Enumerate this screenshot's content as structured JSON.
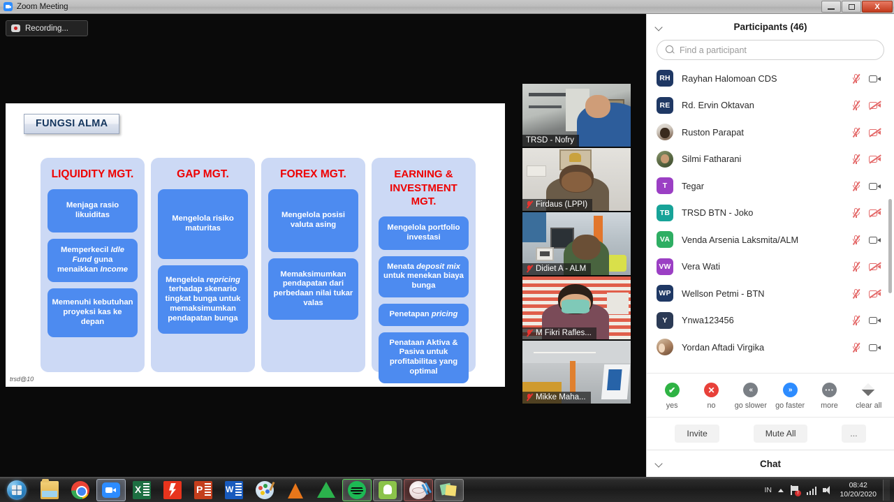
{
  "window": {
    "title": "Zoom Meeting",
    "app_icon": "zoom-icon",
    "minimize_label": "Minimize",
    "maximize_label": "Restore",
    "close_label": "X"
  },
  "stage": {
    "recording_label": "Recording...",
    "recording_icon": "record-icon"
  },
  "slide": {
    "title": "FUNGSI ALMA",
    "footer": "trsd@10",
    "columns": [
      {
        "heading": "LIQUIDITY MGT.",
        "items": [
          {
            "parts": [
              {
                "t": "Menjaga rasio likuiditas",
                "i": false
              }
            ]
          },
          {
            "parts": [
              {
                "t": "Memperkecil ",
                "i": false
              },
              {
                "t": "Idle Fund",
                "i": true
              },
              {
                "t": " guna menaikkan ",
                "i": false
              },
              {
                "t": "Income",
                "i": true
              }
            ]
          },
          {
            "parts": [
              {
                "t": "Memenuhi kebutuhan proyeksi kas ke depan",
                "i": false
              }
            ]
          }
        ]
      },
      {
        "heading": "GAP MGT.",
        "items": [
          {
            "parts": [
              {
                "t": "Mengelola risiko maturitas",
                "i": false
              }
            ]
          },
          {
            "parts": [
              {
                "t": "Mengelola ",
                "i": false
              },
              {
                "t": "repricing",
                "i": true
              },
              {
                "t": " terhadap skenario tingkat bunga untuk memaksimumkan pendapatan bunga",
                "i": false
              }
            ]
          }
        ]
      },
      {
        "heading": "FOREX MGT.",
        "items": [
          {
            "parts": [
              {
                "t": "Mengelola posisi valuta asing",
                "i": false
              }
            ]
          },
          {
            "parts": [
              {
                "t": "Memaksimumkan pendapatan dari perbedaan nilai tukar valas",
                "i": false
              }
            ]
          }
        ]
      },
      {
        "heading": "EARNING & INVESTMENT MGT.",
        "items": [
          {
            "parts": [
              {
                "t": "Mengelola portfolio investasi",
                "i": false
              }
            ]
          },
          {
            "parts": [
              {
                "t": "Menata ",
                "i": false
              },
              {
                "t": "deposit mix",
                "i": true
              },
              {
                "t": " untuk menekan biaya bunga",
                "i": false
              }
            ]
          },
          {
            "parts": [
              {
                "t": "Penetapan ",
                "i": false
              },
              {
                "t": "pricing",
                "i": true
              }
            ]
          },
          {
            "parts": [
              {
                "t": "Penataan Aktiva & Pasiva untuk profitabilitas yang optimal",
                "i": false
              }
            ]
          }
        ]
      }
    ],
    "colors": {
      "heading": "#ee0000",
      "column_bg": "#ccd9f5",
      "box_bg": "#4d8bf0"
    }
  },
  "thumbnails": [
    {
      "name": "TRSD - Nofry",
      "active": true,
      "muted": false
    },
    {
      "name": "Firdaus (LPPI)",
      "active": false,
      "muted": true
    },
    {
      "name": "Didiet A - ALM",
      "active": false,
      "muted": true
    },
    {
      "name": "M Fikri Rafles...",
      "active": false,
      "muted": true
    },
    {
      "name": "Mikke Maha...",
      "active": false,
      "muted": true
    }
  ],
  "panel": {
    "title": "Participants (46)",
    "collapse_icon": "chevron-down-icon",
    "search": {
      "placeholder": "Find a participant",
      "value": "",
      "icon": "search-icon"
    },
    "participants": [
      {
        "name": "Rayhan Halomoan CDS",
        "initials": "RH",
        "avatar_color": "#1f3864",
        "photo": null,
        "mic": "muted",
        "camera": "on"
      },
      {
        "name": "Rd. Ervin Oktavan",
        "initials": "RE",
        "avatar_color": "#1f3864",
        "photo": null,
        "mic": "muted",
        "camera": "off"
      },
      {
        "name": "Ruston Parapat",
        "initials": "",
        "avatar_color": "",
        "photo": "ph-a",
        "mic": "muted",
        "camera": "off"
      },
      {
        "name": "Silmi Fatharani",
        "initials": "",
        "avatar_color": "",
        "photo": "ph-b",
        "mic": "muted",
        "camera": "off"
      },
      {
        "name": "Tegar",
        "initials": "T",
        "avatar_color": "#9b3fc4",
        "photo": null,
        "mic": "muted",
        "camera": "on"
      },
      {
        "name": "TRSD BTN - Joko",
        "initials": "TB",
        "avatar_color": "#17a398",
        "photo": null,
        "mic": "muted",
        "camera": "off"
      },
      {
        "name": "Venda Arsenia Laksmita/ALM",
        "initials": "VA",
        "avatar_color": "#2eae63",
        "photo": null,
        "mic": "muted",
        "camera": "on"
      },
      {
        "name": "Vera Wati",
        "initials": "VW",
        "avatar_color": "#9b3fc4",
        "photo": null,
        "mic": "muted",
        "camera": "off"
      },
      {
        "name": "Wellson Petmi - BTN",
        "initials": "WP",
        "avatar_color": "#1f3864",
        "photo": null,
        "mic": "muted",
        "camera": "off"
      },
      {
        "name": "Ynwa123456",
        "initials": "Y",
        "avatar_color": "#2b3a55",
        "photo": null,
        "mic": "muted",
        "camera": "on"
      },
      {
        "name": "Yordan Aftadi Virgika",
        "initials": "",
        "avatar_color": "",
        "photo": "ph-c",
        "mic": "muted",
        "camera": "on"
      }
    ],
    "reactions": [
      {
        "label": "yes",
        "icon": "check-icon",
        "style": "yes",
        "glyph": "✔"
      },
      {
        "label": "no",
        "icon": "cross-icon",
        "style": "no",
        "glyph": "✕"
      },
      {
        "label": "go slower",
        "icon": "double-chevron-left-icon",
        "style": "slower",
        "glyph": "«"
      },
      {
        "label": "go faster",
        "icon": "double-chevron-right-icon",
        "style": "faster",
        "glyph": "»"
      },
      {
        "label": "more",
        "icon": "ellipsis-icon",
        "style": "more",
        "glyph": "···"
      },
      {
        "label": "clear all",
        "icon": "eraser-icon",
        "style": "eraser",
        "glyph": ""
      }
    ],
    "buttons": {
      "invite": "Invite",
      "mute_all": "Mute All",
      "more": "..."
    },
    "chat_title": "Chat",
    "chat_collapse_icon": "chevron-down-icon"
  },
  "taskbar": {
    "start_icon": "windows-start-icon",
    "items": [
      {
        "icon": "file-explorer-icon",
        "class": "ic-explorer",
        "running": false
      },
      {
        "icon": "google-chrome-icon",
        "class": "ic-chrome",
        "running": false
      },
      {
        "icon": "zoom-icon",
        "class": "ic-zoom",
        "running": true,
        "active": true
      },
      {
        "icon": "microsoft-excel-icon",
        "class": "ic-excel",
        "running": false
      },
      {
        "icon": "nitro-pdf-icon",
        "class": "ic-nitro",
        "running": false
      },
      {
        "icon": "microsoft-powerpoint-icon",
        "class": "ic-ppt",
        "running": false
      },
      {
        "icon": "microsoft-word-icon",
        "class": "ic-word",
        "running": false
      },
      {
        "icon": "paint-icon",
        "class": "ic-paint",
        "running": false
      },
      {
        "icon": "vlc-media-player-icon",
        "class": "ic-vlc",
        "running": false
      },
      {
        "icon": "anydesk-icon",
        "class": "ic-any",
        "running": false
      },
      {
        "icon": "spotify-icon",
        "class": "ic-spotify",
        "running": true
      },
      {
        "icon": "android-emulator-icon",
        "class": "ic-droid",
        "running": true
      },
      {
        "icon": "snipping-tool-icon",
        "class": "ic-snip",
        "running": true
      },
      {
        "icon": "sticky-notes-icon",
        "class": "ic-sticky",
        "running": true
      }
    ],
    "tray": {
      "language": "IN",
      "show_hidden_icon": "chevron-up-icon",
      "action_center_icon": "flag-icon",
      "network_icon": "signal-bars-icon",
      "volume_icon": "speaker-icon",
      "time": "08:42",
      "date": "10/20/2020"
    }
  }
}
